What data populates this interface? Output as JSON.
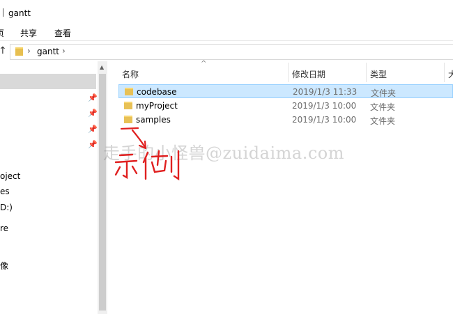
{
  "window": {
    "title": "gantt"
  },
  "ribbon": {
    "tabs": [
      "页",
      "共享",
      "查看"
    ]
  },
  "address": {
    "segments": [
      "gantt"
    ]
  },
  "navpane": {
    "items": [
      "oject",
      "es",
      "D:)",
      "re",
      "像"
    ]
  },
  "columns": {
    "name": "名称",
    "date": "修改日期",
    "type": "类型",
    "size": "大"
  },
  "files": [
    {
      "name": "codebase",
      "date": "2019/1/3 11:33",
      "type": "文件夹",
      "selected": true
    },
    {
      "name": "myProject",
      "date": "2019/1/3 10:00",
      "type": "文件夹",
      "selected": false
    },
    {
      "name": "samples",
      "date": "2019/1/3 10:00",
      "type": "文件夹",
      "selected": false
    }
  ],
  "watermark": "走手的小怪兽@zuidaima.com",
  "annotation": {
    "text": "示例",
    "color": "#e02020"
  },
  "colors": {
    "selection": "#cce8ff",
    "folder": "#e8c156"
  }
}
